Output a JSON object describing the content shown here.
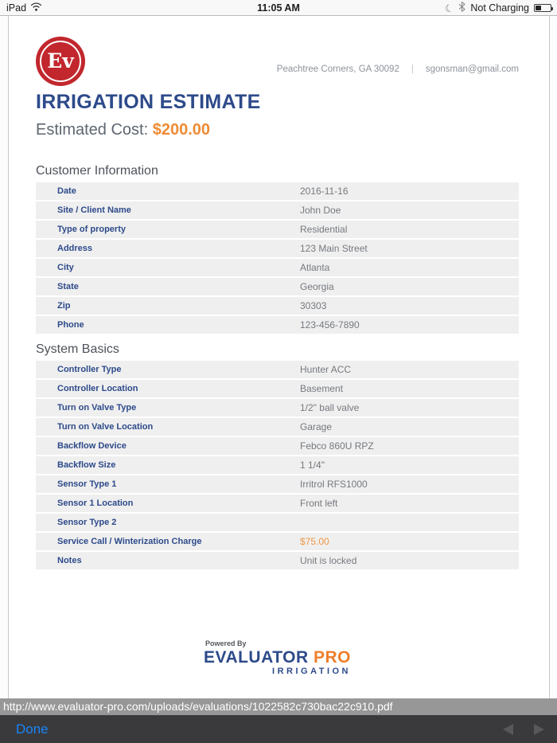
{
  "status_bar": {
    "device": "iPad",
    "time": "11:05 AM",
    "battery_status": "Not Charging"
  },
  "document": {
    "logo_text": "Ev",
    "contact": {
      "location": "Peachtree Corners, GA 30092",
      "separator": "|",
      "email": "sgonsman@gmail.com"
    },
    "title": "IRRIGATION ESTIMATE",
    "estimated_cost_label": "Estimated Cost:",
    "estimated_cost_value": "$200.00",
    "sections": [
      {
        "heading": "Customer Information",
        "rows": [
          {
            "label": "Date",
            "value": "2016-11-16"
          },
          {
            "label": "Site / Client Name",
            "value": "John Doe"
          },
          {
            "label": "Type of property",
            "value": "Residential"
          },
          {
            "label": "Address",
            "value": "123 Main Street"
          },
          {
            "label": "City",
            "value": "Atlanta"
          },
          {
            "label": "State",
            "value": "Georgia"
          },
          {
            "label": "Zip",
            "value": "30303"
          },
          {
            "label": "Phone",
            "value": "123-456-7890"
          }
        ]
      },
      {
        "heading": "System Basics",
        "rows": [
          {
            "label": "Controller Type",
            "value": "Hunter ACC"
          },
          {
            "label": "Controller Location",
            "value": "Basement"
          },
          {
            "label": "Turn on Valve Type",
            "value": "1/2\" ball valve"
          },
          {
            "label": "Turn on Valve Location",
            "value": "Garage"
          },
          {
            "label": "Backflow Device",
            "value": "Febco 860U RPZ"
          },
          {
            "label": "Backflow Size",
            "value": "1 1/4\""
          },
          {
            "label": "Sensor Type 1",
            "value": "Irritrol RFS1000"
          },
          {
            "label": "Sensor 1 Location",
            "value": "Front left"
          },
          {
            "label": "Sensor Type 2",
            "value": ""
          },
          {
            "label": "Service Call / Winterization Charge",
            "value": "$75.00",
            "highlight": true
          },
          {
            "label": "Notes",
            "value": "Unit is locked"
          }
        ]
      }
    ],
    "footer": {
      "powered_by": "Powered By",
      "brand_primary": "EVALUATOR",
      "brand_accent": "PRO",
      "brand_sub": "IRRIGATION"
    }
  },
  "browser": {
    "url": "http://www.evaluator-pro.com/uploads/evaluations/1022582c730bac22c910.pdf",
    "done_label": "Done"
  },
  "colors": {
    "navy": "#2d4a8a",
    "orange": "#ee8b35",
    "logo_red": "#c1272d",
    "row_bg": "#efefef",
    "toolbar_bg": "#3a3a3c",
    "done_blue": "#1785fc"
  }
}
